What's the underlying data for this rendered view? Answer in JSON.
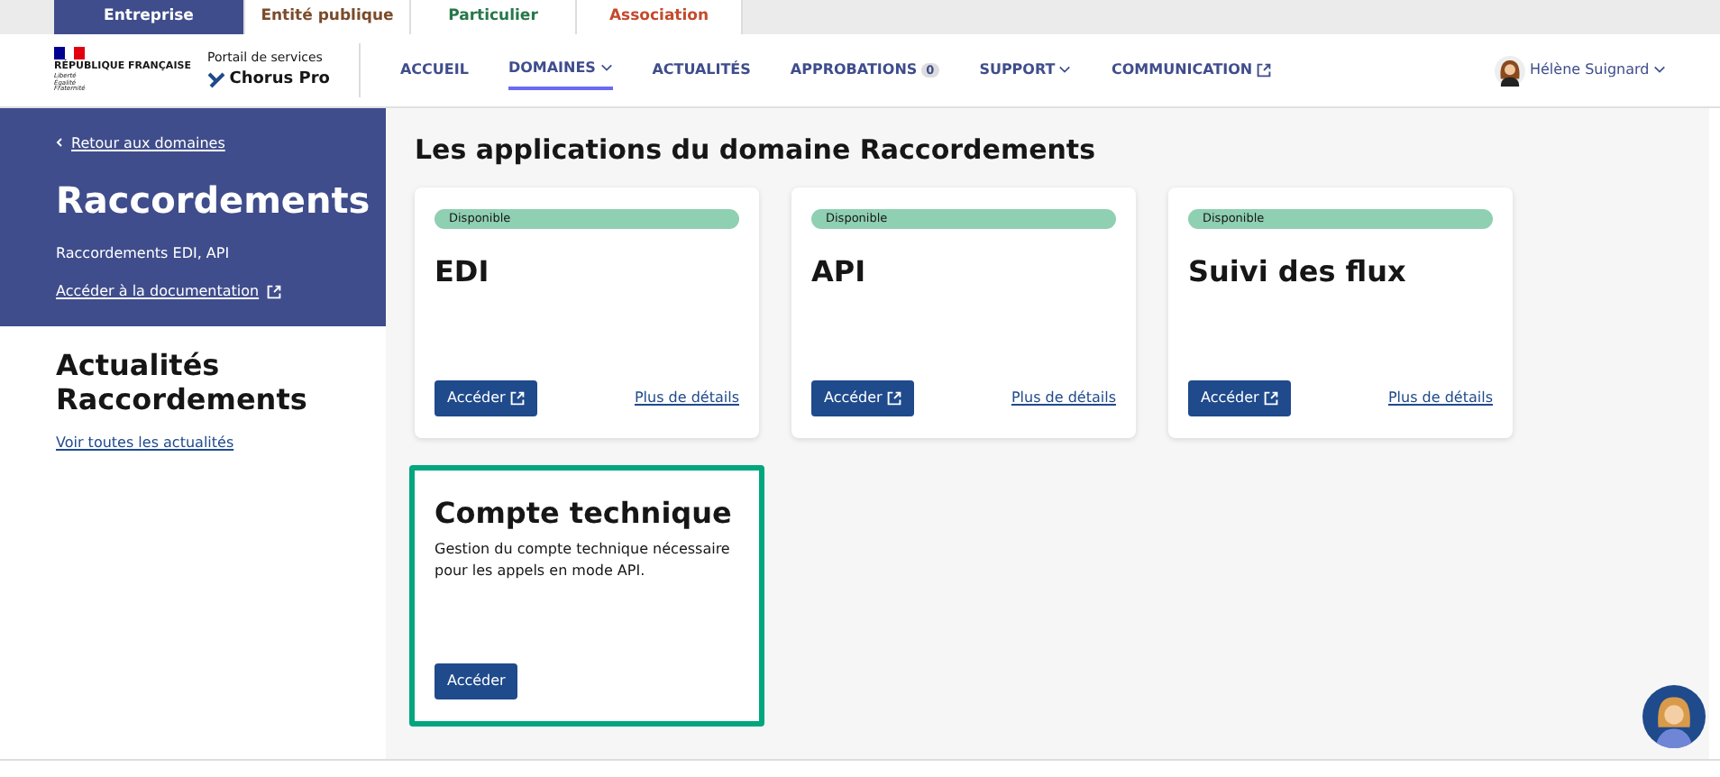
{
  "audience_tabs": [
    {
      "label": "Entreprise",
      "selected": true,
      "color": "#3f4d8c"
    },
    {
      "label": "Entité publique",
      "selected": false,
      "color": "#7b4b2a"
    },
    {
      "label": "Particulier",
      "selected": false,
      "color": "#27774a"
    },
    {
      "label": "Association",
      "selected": false,
      "color": "#c44a2c"
    }
  ],
  "header": {
    "brand": "RÉPUBLIQUE FRANÇAISE",
    "motto": "Liberté Égalité Fraternité",
    "portal_caption": "Portail de services",
    "portal_name": "Chorus Pro",
    "nav": [
      {
        "label": "ACCUEIL",
        "kind": "plain",
        "selected": false
      },
      {
        "label": "DOMAINES",
        "kind": "menu",
        "selected": true
      },
      {
        "label": "ACTUALITÉS",
        "kind": "plain",
        "selected": false
      },
      {
        "label": "APPROBATIONS",
        "kind": "count",
        "count": "0",
        "selected": false
      },
      {
        "label": "SUPPORT",
        "kind": "menu",
        "selected": false
      },
      {
        "label": "COMMUNICATION",
        "kind": "external",
        "selected": false
      }
    ],
    "user": "Hélène Suignard"
  },
  "sidebar": {
    "back_link": "Retour aux domaines",
    "title": "Raccordements",
    "subtitle": "Raccordements EDI, API",
    "doc_link": "Accéder à la documentation",
    "news_title": "Actualités Raccordements",
    "news_link": "Voir toutes les actualités"
  },
  "main": {
    "heading": "Les applications du domaine Raccordements",
    "apps": [
      {
        "status": "Disponible",
        "title": "EDI",
        "button": "Accéder",
        "external": true,
        "details_link": "Plus de détails",
        "selected": false
      },
      {
        "status": "Disponible",
        "title": "API",
        "button": "Accéder",
        "external": true,
        "details_link": "Plus de détails",
        "selected": false
      },
      {
        "status": "Disponible",
        "title": "Suivi des flux",
        "button": "Accéder",
        "external": true,
        "details_link": "Plus de détails",
        "selected": false
      },
      {
        "title": "Compte technique",
        "description": "Gestion du compte technique nécessaire pour les appels en mode API.",
        "button": "Accéder",
        "external": false,
        "selected": true
      }
    ]
  }
}
